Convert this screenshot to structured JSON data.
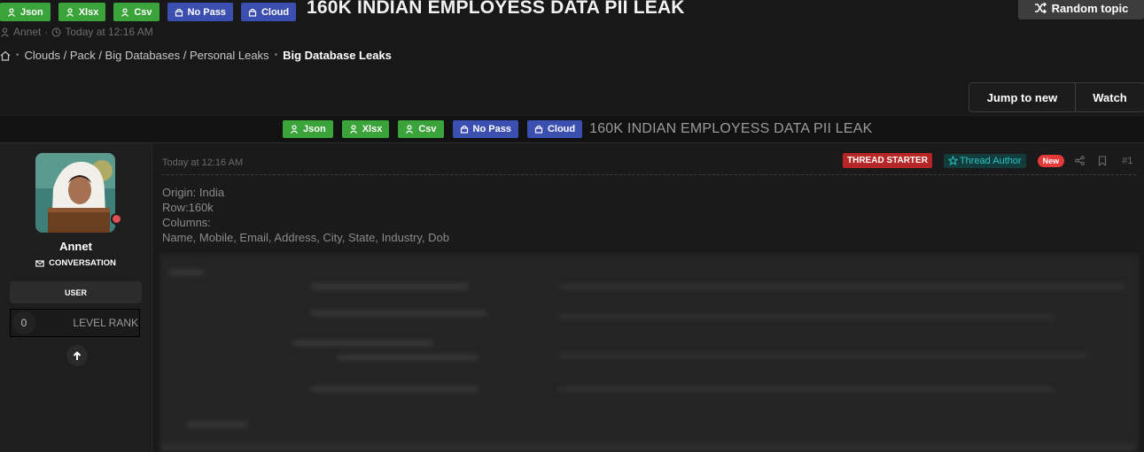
{
  "thread": {
    "tags": [
      {
        "label": "Json",
        "kind": "user",
        "color": "#3aa33a"
      },
      {
        "label": "Xlsx",
        "kind": "user",
        "color": "#3aa33a"
      },
      {
        "label": "Csv",
        "kind": "user",
        "color": "#3aa33a"
      },
      {
        "label": "No Pass",
        "kind": "lock",
        "color": "#3b4fb0"
      },
      {
        "label": "Cloud",
        "kind": "lock",
        "color": "#3b4fb0"
      }
    ],
    "title": "160K INDIAN EMPLOYESS DATA PII LEAK",
    "author": "Annet",
    "time": "Today at 12:16 AM"
  },
  "random_topic_label": "Random topic",
  "breadcrumb": {
    "path": "Clouds / Pack / Big Databases / Personal Leaks",
    "current": "Big Database Leaks"
  },
  "actions": {
    "jump": "Jump to new",
    "watch": "Watch"
  },
  "user": {
    "name": "Annet",
    "conversation_label": "CONVERSATION",
    "role": "USER",
    "level": "0",
    "level_label": "LEVEL RANK"
  },
  "post": {
    "date": "Today at 12:16 AM",
    "badges": {
      "starter": "THREAD STARTER",
      "author": "Thread Author",
      "new": "New"
    },
    "number": "#1",
    "lines": [
      "Origin: India",
      "Row:160k",
      "Columns:",
      "Name, Mobile, Email, Address, City, State, Industry, Dob"
    ]
  },
  "colors": {
    "green_tag": "#3aa33a",
    "blue_tag": "#3b4fb0",
    "starter": "#b62626",
    "new": "#e53a3a",
    "author_text": "#2ec4c4"
  }
}
